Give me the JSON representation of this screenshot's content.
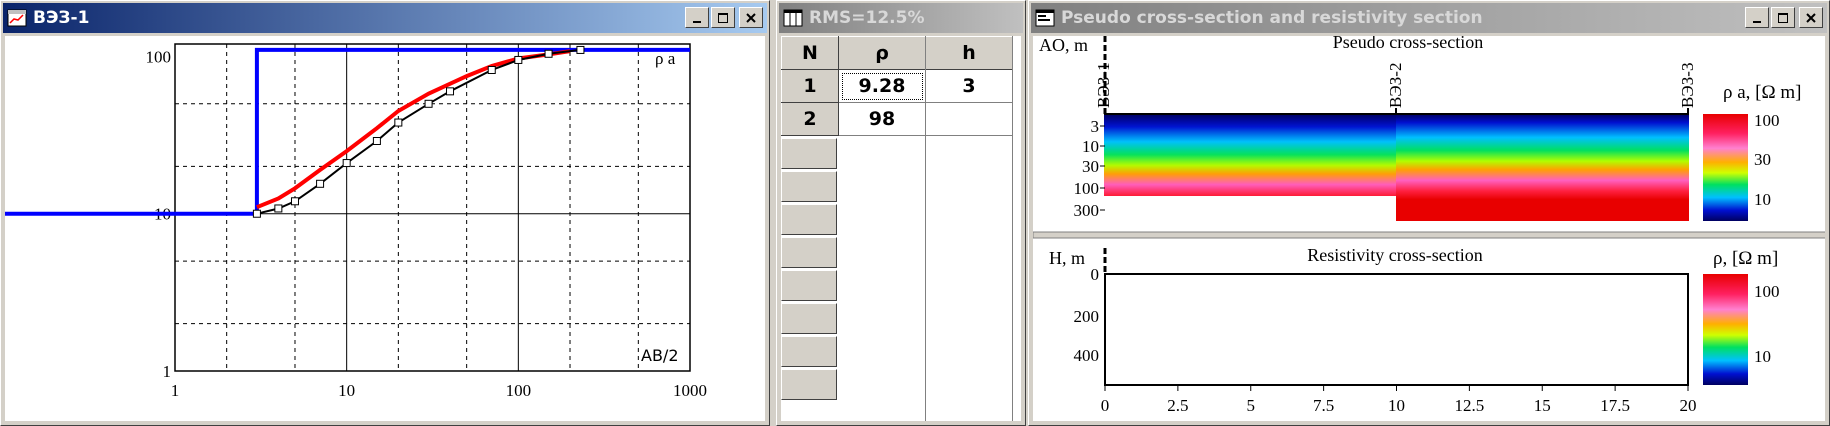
{
  "ves_window": {
    "title": "ВЭЗ-1",
    "curve_label": "ρ a",
    "x_axis_label": "AB/2",
    "x_ticks": [
      "1",
      "10",
      "100",
      "1000"
    ],
    "y_ticks": [
      "100",
      "10",
      "1"
    ],
    "colors": {
      "model": "#0000ff",
      "computed": "#ff0000",
      "observed": "#000000"
    }
  },
  "table_window": {
    "title": "RMS=12.5%",
    "columns": [
      "N",
      "ρ",
      "h"
    ],
    "rows": [
      {
        "n": "1",
        "rho": "9.28",
        "h": "3"
      },
      {
        "n": "2",
        "rho": "98",
        "h": ""
      }
    ]
  },
  "section_window": {
    "title": "Pseudo cross-section and resistivity section",
    "pseudo": {
      "title": "Pseudo cross-section",
      "y_label": "AO, m",
      "y_ticks": [
        "3",
        "10",
        "30",
        "100",
        "300"
      ],
      "stations": [
        "ВЭЗ-1",
        "ВЭЗ-2",
        "ВЭЗ-3"
      ],
      "legend_title": "ρ a, [Ω m]",
      "legend_ticks": [
        "100",
        "30",
        "10"
      ]
    },
    "resistivity": {
      "title": "Resistivity cross-section",
      "y_label": "H, m",
      "y_ticks": [
        "0",
        "200",
        "400"
      ],
      "x_ticks": [
        "0",
        "2.5",
        "5",
        "7.5",
        "10",
        "12.5",
        "15",
        "17.5",
        "20"
      ],
      "legend_title": "ρ, [Ω m]",
      "legend_ticks": [
        "100",
        "10"
      ]
    }
  },
  "chart_data": {
    "type": "line",
    "title": "",
    "xlabel": "AB/2",
    "ylabel": "ρ a",
    "x_scale": "log",
    "y_scale": "log",
    "xlim": [
      1,
      1000
    ],
    "ylim": [
      1,
      120
    ],
    "grid": true,
    "series": [
      {
        "key": "model",
        "x": [
          1,
          3,
          3,
          1000
        ],
        "y": [
          10,
          10,
          110,
          110
        ]
      },
      {
        "key": "computed",
        "x": [
          3,
          4,
          5,
          7,
          10,
          15,
          20,
          30,
          50,
          70,
          100,
          150,
          200
        ],
        "y": [
          11,
          12.5,
          14.5,
          19,
          25,
          35,
          45,
          58,
          75,
          87,
          97,
          103,
          108
        ]
      },
      {
        "key": "observed",
        "x": [
          3,
          4,
          5,
          7,
          10,
          15,
          20,
          30,
          40,
          70,
          100,
          150,
          230
        ],
        "y": [
          10,
          10.8,
          12,
          15.5,
          21,
          29,
          38,
          50,
          60,
          82,
          95,
          104,
          110
        ]
      }
    ]
  }
}
